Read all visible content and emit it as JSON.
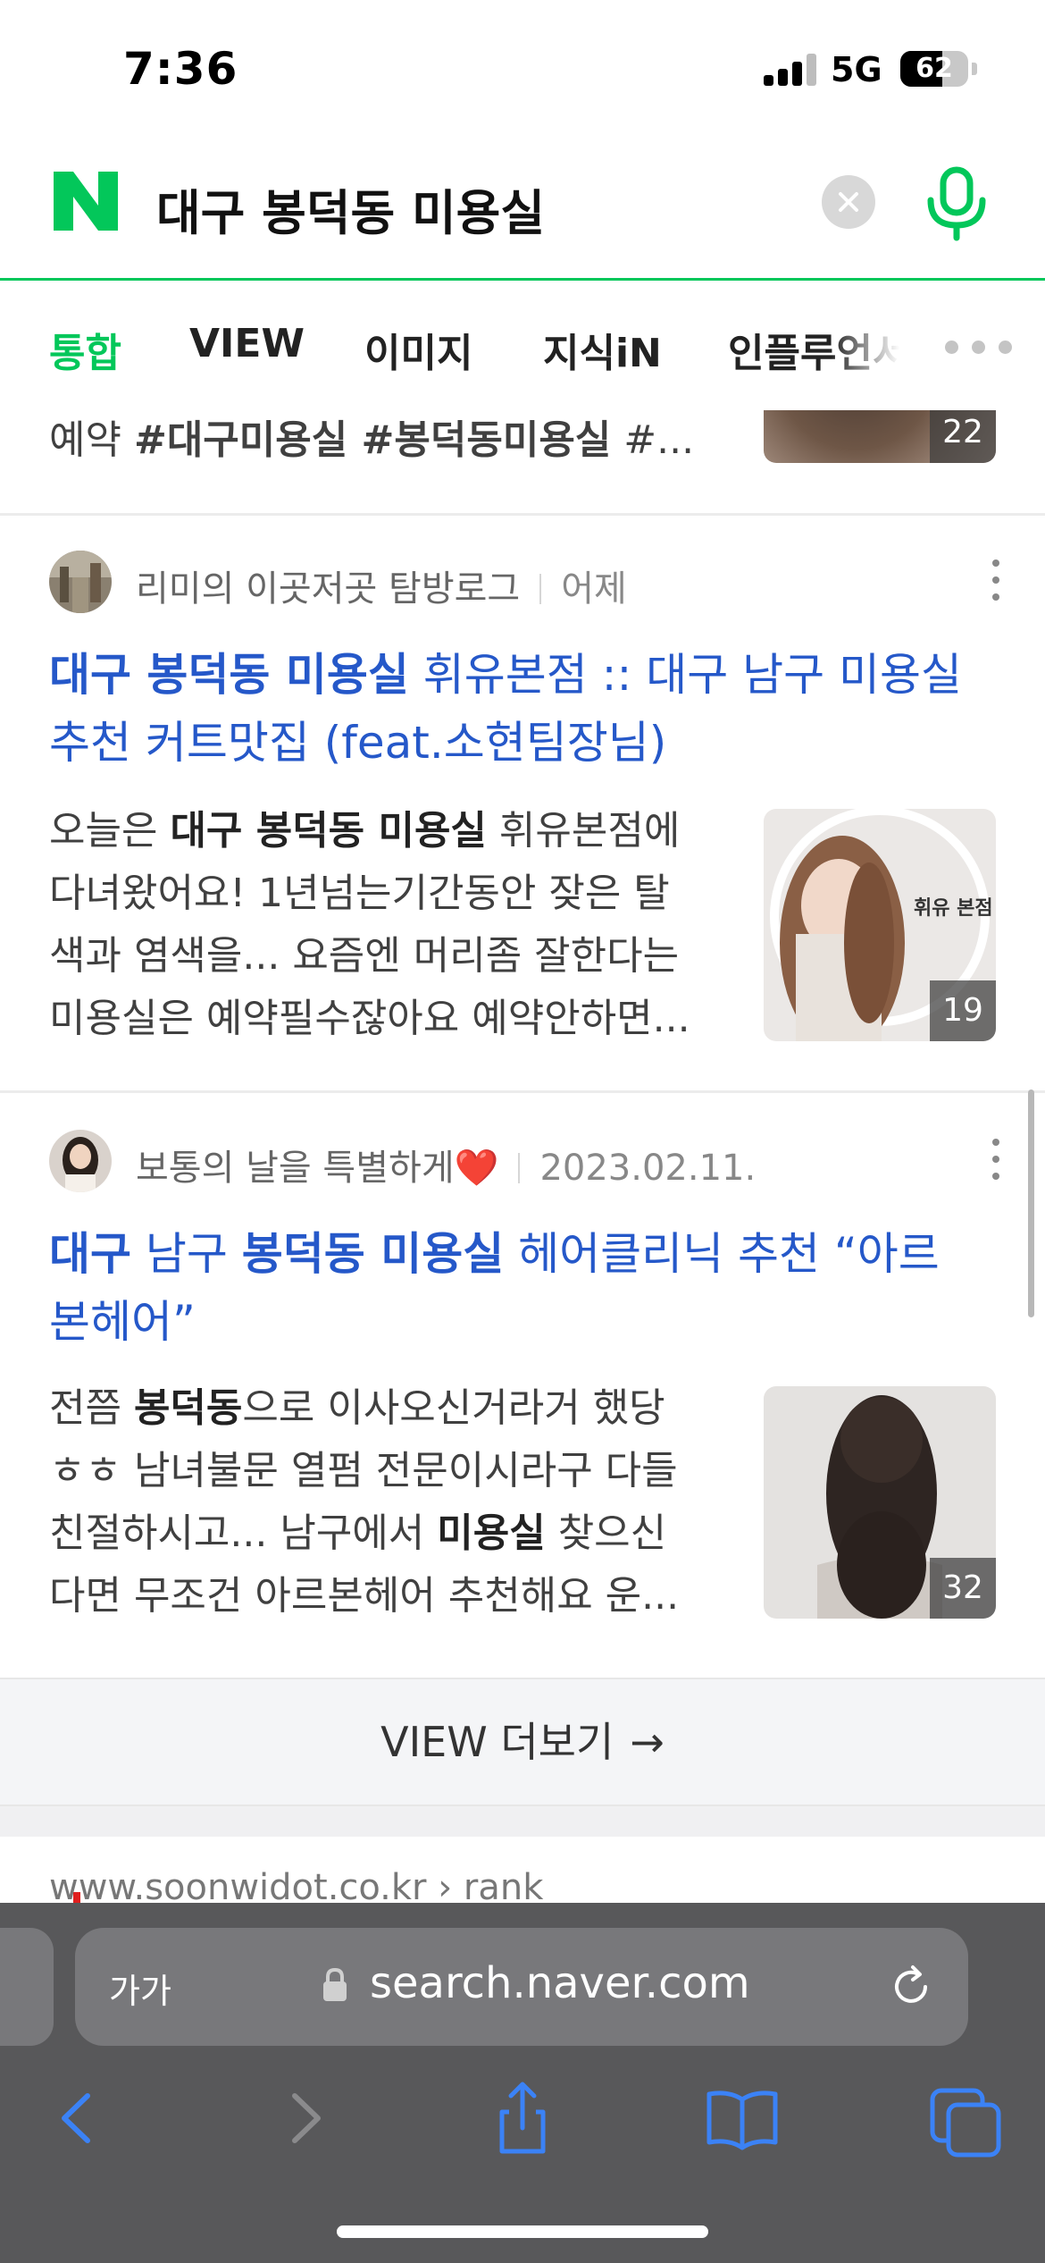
{
  "status_bar": {
    "time": "7:36",
    "network": "5G",
    "battery": "62"
  },
  "search": {
    "query": "대구 봉덕동 미용실"
  },
  "tabs": [
    {
      "label": "통합",
      "active": true
    },
    {
      "label": "VIEW",
      "active": false
    },
    {
      "label": "이미지",
      "active": false
    },
    {
      "label": "지식iN",
      "active": false
    },
    {
      "label": "인플루언서",
      "active": false
    }
  ],
  "partial_result": {
    "snippet_prefix": "예약 ",
    "snippet_tags": "#대구미용실 #봉덕동미용실",
    "snippet_suffix": " #...",
    "image_count": "22"
  },
  "posts": [
    {
      "author": "리미의 이곳저곳 탐방로그",
      "date": "어제",
      "title_bold": "대구 봉덕동 미용실",
      "title_rest_line1": " 휘유본점 :: 대구 남구 미용실",
      "title_line2": "추천 커트맛집 (feat.소현팀장님)",
      "snippet_lines": [
        {
          "pre": "오늘은 ",
          "bold": "대구 봉덕동 미용실",
          "post": " 휘유본점에"
        },
        {
          "pre": "다녀왔어요! 1년넘는기간동안 잦은 탈",
          "bold": "",
          "post": ""
        },
        {
          "pre": "색과 염색을... 요즘엔 머리좀 잘한다는",
          "bold": "",
          "post": ""
        },
        {
          "pre": "미용실은 예약필수잖아요 예약안하면...",
          "bold": "",
          "post": ""
        }
      ],
      "image_count": "19",
      "image_caption": "휘유 본점"
    },
    {
      "author": "보통의 날을 특별하게",
      "author_emoji": "❤️",
      "date": "2023.02.11.",
      "title_bold_1": "대구",
      "title_mid": " 남구 ",
      "title_bold_2": "봉덕동 미용실",
      "title_rest_line1": " 헤어클리닉 추천 “아르",
      "title_line2": "본헤어”",
      "snippet_lines": [
        {
          "pre": "전쯤 ",
          "bold": "봉덕동",
          "post": "으로 이사오신거라거 했당"
        },
        {
          "pre": "ㅎㅎ 남녀불문 열펌 전문이시라구 다들",
          "bold": "",
          "post": ""
        },
        {
          "pre": "친절하시고... 남구에서 ",
          "bold": "미용실",
          "post": " 찾으신"
        },
        {
          "pre": "다면 무조건 아르본헤어 추천해요 운...",
          "bold": "",
          "post": ""
        }
      ],
      "image_count": "32"
    }
  ],
  "view_more": {
    "label": "VIEW 더보기",
    "arrow": "→"
  },
  "next_card_hint": "www.soonwidot.co.kr › rank",
  "browser": {
    "aa_label": "가가",
    "url": "search.naver.com"
  },
  "colors": {
    "naver_green": "#03c75a",
    "title_blue": "#2558c9",
    "browser_bg": "#58585a",
    "toolbar_icon": "#3b82f6"
  },
  "icons": {
    "logo": "naver-n-logo",
    "clear": "clear-icon",
    "mic": "microphone-icon",
    "more": "more-dots-icon",
    "kebab": "kebab-menu-icon",
    "lock": "lock-icon",
    "reload": "reload-icon",
    "back": "back-icon",
    "forward": "forward-icon",
    "share": "share-icon",
    "bookmarks": "bookmarks-icon",
    "tabs": "tabs-icon"
  }
}
